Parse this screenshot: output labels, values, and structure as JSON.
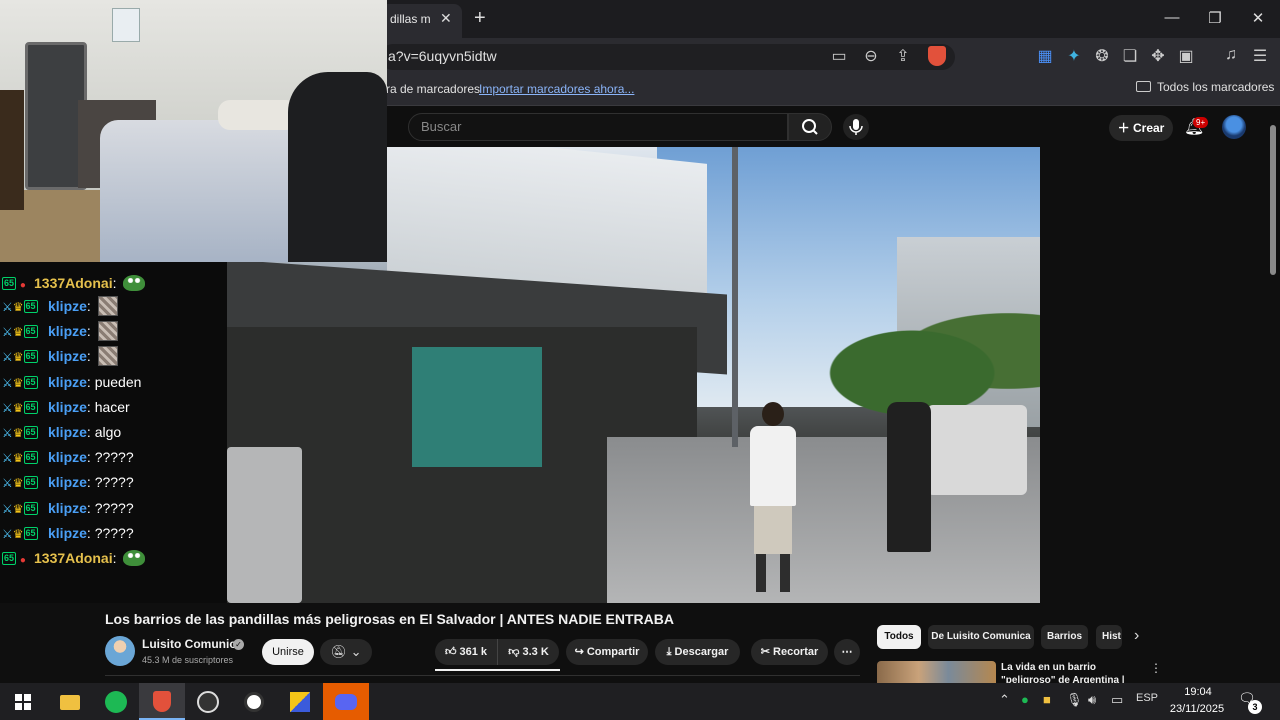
{
  "browser": {
    "tab_title": "dillas m",
    "url": "a?v=6uqyvn5idtw",
    "bookmarks_prefix": "ra de marcadores",
    "bookmarks_import_link": "Importar marcadores ahora...",
    "all_bookmarks": "Todos los marcadores",
    "accent_color": "#e2513b"
  },
  "youtube": {
    "search_placeholder": "Buscar",
    "create_label": "Crear",
    "notifications_badge": "9+"
  },
  "chat": {
    "messages": [
      {
        "user": "1337Adonai",
        "text": ""
      },
      {
        "user": "klipze",
        "text": ""
      },
      {
        "user": "klipze",
        "text": ""
      },
      {
        "user": "klipze",
        "text": ""
      },
      {
        "user": "klipze",
        "text": "pueden"
      },
      {
        "user": "klipze",
        "text": "hacer"
      },
      {
        "user": "klipze",
        "text": "algo"
      },
      {
        "user": "klipze",
        "text": "?????"
      },
      {
        "user": "klipze",
        "text": "?????"
      },
      {
        "user": "klipze",
        "text": "?????"
      },
      {
        "user": "klipze",
        "text": "?????"
      },
      {
        "user": "1337Adonai",
        "text": ""
      }
    ]
  },
  "video": {
    "title": "Los barrios de las pandillas más peligrosas en El Salvador | ANTES NADIE ENTRABA",
    "channel": "Luisito Comunica",
    "subscribers": "45.3 M de suscriptores",
    "join_label": "Unirse",
    "likes": "361 k",
    "dislikes": "3.3 K",
    "share_label": "Compartir",
    "download_label": "Descargar",
    "clip_label": "Recortar"
  },
  "related": {
    "chips": [
      "Todos",
      "De Luisito Comunica",
      "Barrios",
      "Hist"
    ],
    "first_title": "La vida en un barrio \"peligroso\" de Argentina | FUERTE APACH"
  },
  "taskbar": {
    "language": "ESP",
    "time": "19:04",
    "date": "23/11/2025",
    "notifications": "3"
  }
}
